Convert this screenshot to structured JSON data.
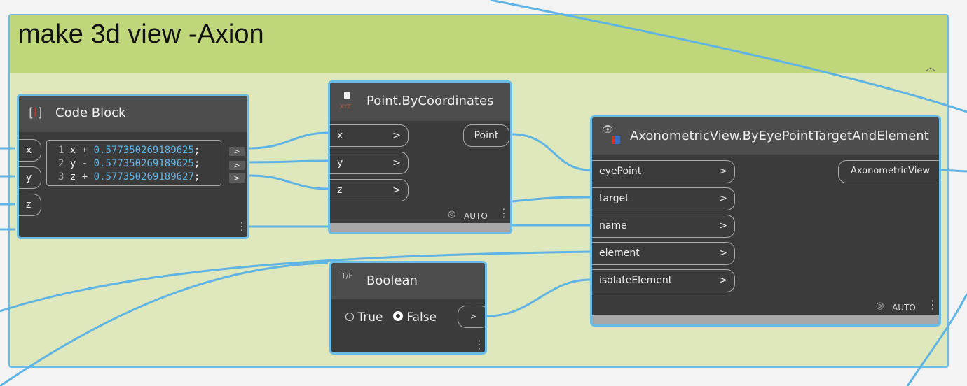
{
  "group": {
    "title": "make 3d view -Axion"
  },
  "code_block": {
    "title": "Code Block",
    "inputs": [
      "x",
      "y",
      "z"
    ],
    "lines": [
      {
        "n": "1",
        "var": "x",
        "op": "+",
        "num": "0.577350269189625",
        "end": ";"
      },
      {
        "n": "2",
        "var": "y",
        "op": "-",
        "num": "0.577350269189625",
        "end": ";"
      },
      {
        "n": "3",
        "var": "z",
        "op": "+",
        "num": "0.577350269189627",
        "end": ";"
      }
    ],
    "out": ">"
  },
  "point": {
    "title": "Point.ByCoordinates",
    "icon_text": "XYZ",
    "inputs": [
      "x",
      "y",
      "z"
    ],
    "output": "Point",
    "lacing": "AUTO"
  },
  "boolean": {
    "title": "Boolean",
    "icon_text": "T/F",
    "true_label": "True",
    "false_label": "False",
    "selected": "False",
    "out": ">"
  },
  "axon": {
    "title": "AxonometricView.ByEyePointTargetAndElement",
    "inputs": [
      "eyePoint",
      "target",
      "name",
      "element",
      "isolateElement"
    ],
    "output": "AxonometricView",
    "lacing": "AUTO"
  },
  "chev": ">",
  "colors": {
    "wire": "#5fb4e3",
    "group_header": "#c0d67a",
    "group_body": "#dfe8bc",
    "node": "#3b3b3b"
  }
}
